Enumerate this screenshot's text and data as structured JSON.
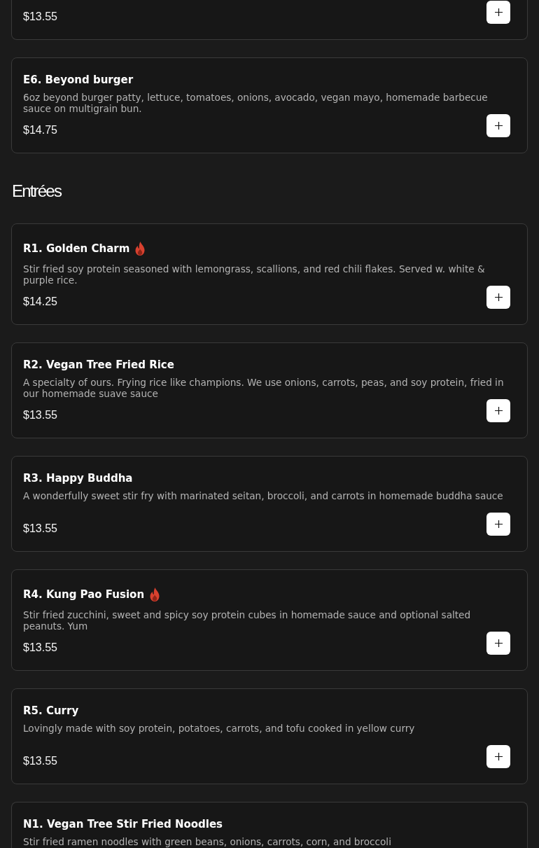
{
  "sections": [
    {
      "items": [
        {
          "price": "$13.55"
        },
        {
          "name": "E6. Beyond burger",
          "spicy": false,
          "description": "6oz beyond burger patty, lettuce, tomatoes, onions, avocado, vegan mayo, homemade barbecue sauce on multigrain bun.",
          "price": "$14.75"
        }
      ]
    },
    {
      "title": "Entrées",
      "items": [
        {
          "name": "R1. Golden Charm",
          "spicy": true,
          "description": "Stir fried soy protein seasoned with lemongrass, scallions, and red chili flakes. Served w. white & purple rice.",
          "price": "$14.25"
        },
        {
          "name": "R2. Vegan Tree Fried Rice",
          "spicy": false,
          "description": "A specialty of ours. Frying rice like champions. We use onions, carrots, peas, and soy protein, fried in our homemade suave sauce",
          "price": "$13.55"
        },
        {
          "name": "R3. Happy Buddha",
          "spicy": false,
          "description": "A wonderfully sweet stir fry with marinated seitan, broccoli, and carrots in homemade buddha sauce",
          "price": "$13.55"
        },
        {
          "name": "R4. Kung Pao Fusion",
          "spicy": true,
          "description": "Stir fried zucchini, sweet and spicy soy protein cubes in homemade sauce and optional salted peanuts. Yum",
          "price": "$13.55"
        },
        {
          "name": "R5. Curry",
          "spicy": false,
          "description": "Lovingly made with soy protein, potatoes, carrots, and tofu cooked in yellow curry",
          "price": "$13.55"
        },
        {
          "name": "N1. Vegan Tree Stir Fried Noodles",
          "spicy": false,
          "description": "Stir fried ramen noodles with green beans, onions, carrots, corn, and broccoli"
        }
      ]
    }
  ]
}
